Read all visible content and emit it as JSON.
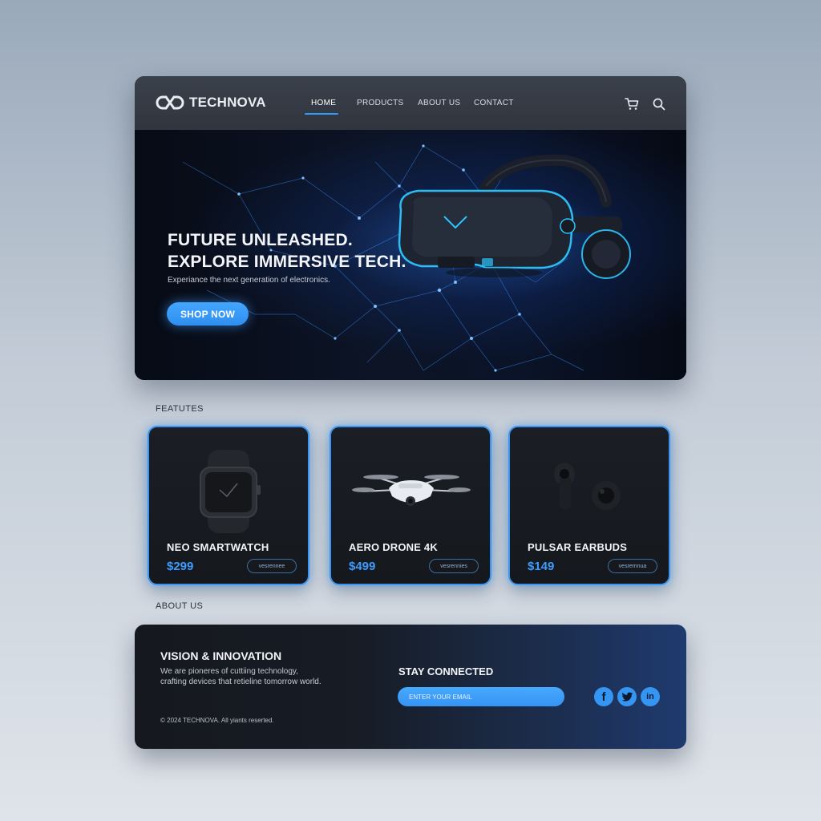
{
  "brand": {
    "name": "TECHNOVA"
  },
  "nav": {
    "links": [
      {
        "label": "HOME",
        "active": true
      },
      {
        "label": "PRODUCTS",
        "active": false
      },
      {
        "label": "ABOUT US",
        "active": false
      },
      {
        "label": "CONTACT",
        "active": false
      }
    ],
    "icons": [
      "cart-icon",
      "search-icon"
    ]
  },
  "hero": {
    "headline_line1": "FUTURE UNLEASHED.",
    "headline_line2": "EXPLORE IMMERSIVE TECH.",
    "subtitle": "Experiance the next generation of electronics.",
    "cta_label": "SHOP NOW",
    "image": "vr-headset"
  },
  "features": {
    "label": "FEATUTES",
    "products": [
      {
        "name": "NEO SMARTWATCH",
        "price": "$299",
        "button_label": "vesrennee",
        "image": "smartwatch"
      },
      {
        "name": "AERO DRONE 4K",
        "price": "$499",
        "button_label": "vesrennies",
        "image": "drone"
      },
      {
        "name": "PULSAR EARBUDS",
        "price": "$149",
        "button_label": "vesremnua",
        "image": "earbuds"
      }
    ]
  },
  "about": {
    "label": "ABOUT US",
    "title": "VISION & INNOVATION",
    "text_line1": "We are pioneres of cuttiing technology,",
    "text_line2": "crafting devices that retieline tomorrow world.",
    "copyright": "© 2024 TECHNOVA. All yiants reserted.",
    "stay_title": "STAY CONNECTED",
    "email_placeholder": "ENTER YOUR EMAIL",
    "socials": [
      {
        "icon": "facebook-icon",
        "glyph": "f"
      },
      {
        "icon": "twitter-icon",
        "glyph": "t"
      },
      {
        "icon": "linkedin-icon",
        "glyph": "in"
      }
    ]
  },
  "colors": {
    "accent": "#2f9bff",
    "nav_bg": "#353a43",
    "card_bg": "#1a1d22",
    "page_bg_top": "#9aa9ba",
    "page_bg_bottom": "#dfe4ea"
  }
}
